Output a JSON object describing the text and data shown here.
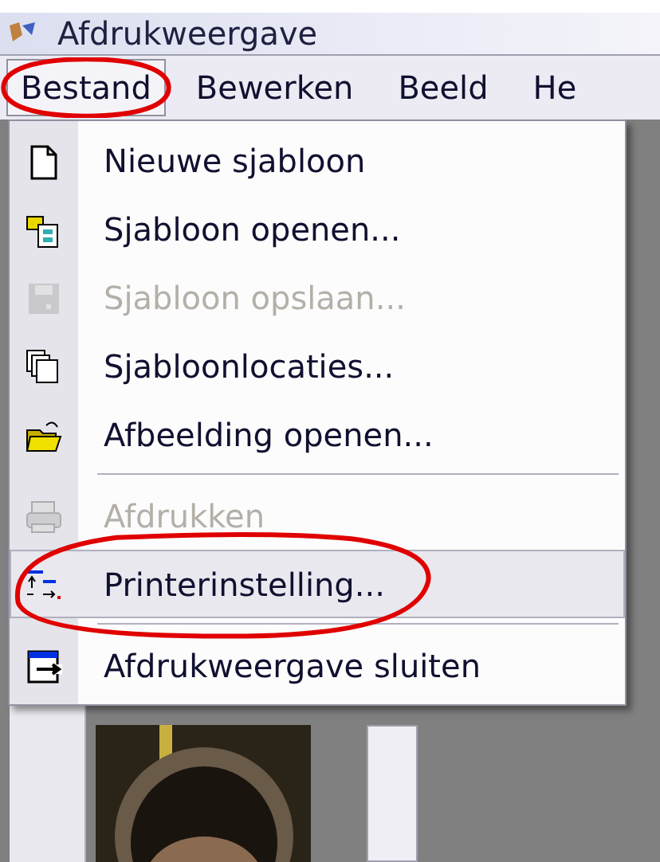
{
  "window": {
    "title": "Afdrukweergave"
  },
  "menu_bar": [
    {
      "label": "Bestand",
      "selected": true,
      "circled": true
    },
    {
      "label": "Bewerken",
      "selected": false,
      "circled": false
    },
    {
      "label": "Beeld",
      "selected": false,
      "circled": false
    },
    {
      "label": "He",
      "selected": false,
      "circled": false
    }
  ],
  "menu": [
    {
      "kind": "item",
      "label": "Nieuwe sjabloon",
      "disabled": false,
      "selected": false,
      "circled": false
    },
    {
      "kind": "item",
      "label": "Sjabloon openen...",
      "disabled": false,
      "selected": false,
      "circled": false
    },
    {
      "kind": "item",
      "label": "Sjabloon opslaan...",
      "disabled": true,
      "selected": false,
      "circled": false
    },
    {
      "kind": "item",
      "label": "Sjabloonlocaties...",
      "disabled": false,
      "selected": false,
      "circled": false
    },
    {
      "kind": "item",
      "label": "Afbeelding openen...",
      "disabled": false,
      "selected": false,
      "circled": false
    },
    {
      "kind": "separator"
    },
    {
      "kind": "item",
      "label": "Afdrukken",
      "disabled": true,
      "selected": false,
      "circled": false
    },
    {
      "kind": "item",
      "label": "Printerinstelling...",
      "disabled": false,
      "selected": true,
      "circled": true
    },
    {
      "kind": "separator"
    },
    {
      "kind": "item",
      "label": "Afdrukweergave sluiten",
      "disabled": false,
      "selected": false,
      "circled": false
    }
  ]
}
